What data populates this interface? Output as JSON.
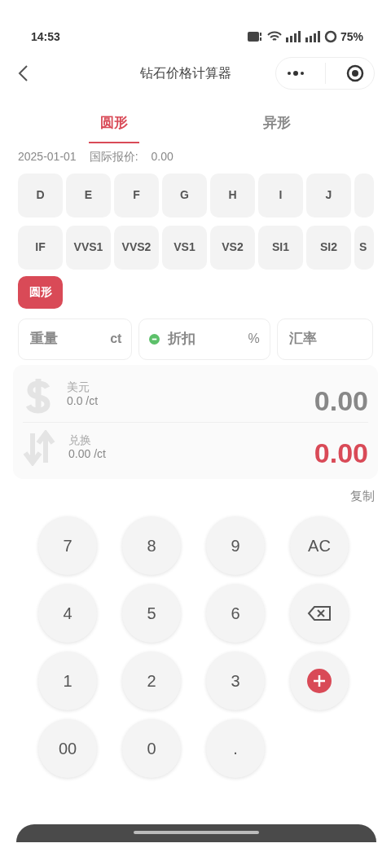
{
  "status_bar": {
    "time": "14:53",
    "battery": "75%"
  },
  "nav": {
    "title": "钻石价格计算器"
  },
  "tabs": [
    {
      "label": "圆形",
      "selected": true
    },
    {
      "label": "异形",
      "selected": false
    }
  ],
  "price_line": {
    "date": "2025-01-01",
    "label": "国际报价:",
    "value": "0.00"
  },
  "colors": [
    {
      "label": "D",
      "selected": false
    },
    {
      "label": "E",
      "selected": false
    },
    {
      "label": "F",
      "selected": false
    },
    {
      "label": "G",
      "selected": false
    },
    {
      "label": "H",
      "selected": false
    },
    {
      "label": "I",
      "selected": false
    },
    {
      "label": "J",
      "selected": false
    },
    {
      "cut": true,
      "selected": false
    }
  ],
  "clarities": [
    {
      "label": "IF",
      "selected": false
    },
    {
      "label": "VVS1",
      "selected": false
    },
    {
      "label": "VVS2",
      "selected": false
    },
    {
      "label": "VS1",
      "selected": false
    },
    {
      "label": "VS2",
      "selected": false
    },
    {
      "label": "SI1",
      "selected": false
    },
    {
      "label": "SI2",
      "selected": false
    },
    {
      "label": "S",
      "cut": true,
      "selected": false
    }
  ],
  "shapes": [
    {
      "label": "圆形",
      "selected": true
    }
  ],
  "inputs": [
    {
      "placeholder": "重量",
      "unit": "ct"
    },
    {
      "placeholder": "折扣",
      "unit": "%",
      "minus": true
    },
    {
      "placeholder": "汇率"
    }
  ],
  "results": [
    {
      "kind": "dollar",
      "label": "美元",
      "unit_price": "0.0 /ct",
      "total": "0.00"
    },
    {
      "kind": "exchange",
      "label": "兑换",
      "unit_price": "0.00 /ct",
      "total": "0.00"
    }
  ],
  "copy": "复制",
  "keys": [
    {
      "kind": "text",
      "label": "7"
    },
    {
      "kind": "text",
      "label": "8"
    },
    {
      "kind": "text",
      "label": "9"
    },
    {
      "kind": "text",
      "label": "AC"
    },
    {
      "kind": "text",
      "label": "4"
    },
    {
      "kind": "text",
      "label": "5"
    },
    {
      "kind": "text",
      "label": "6"
    },
    {
      "kind": "backspace"
    },
    {
      "kind": "text",
      "label": "1"
    },
    {
      "kind": "text",
      "label": "2"
    },
    {
      "kind": "text",
      "label": "3"
    },
    {
      "kind": "add"
    },
    {
      "kind": "text",
      "label": "00"
    },
    {
      "kind": "text",
      "label": "0"
    },
    {
      "kind": "text",
      "label": "."
    }
  ]
}
